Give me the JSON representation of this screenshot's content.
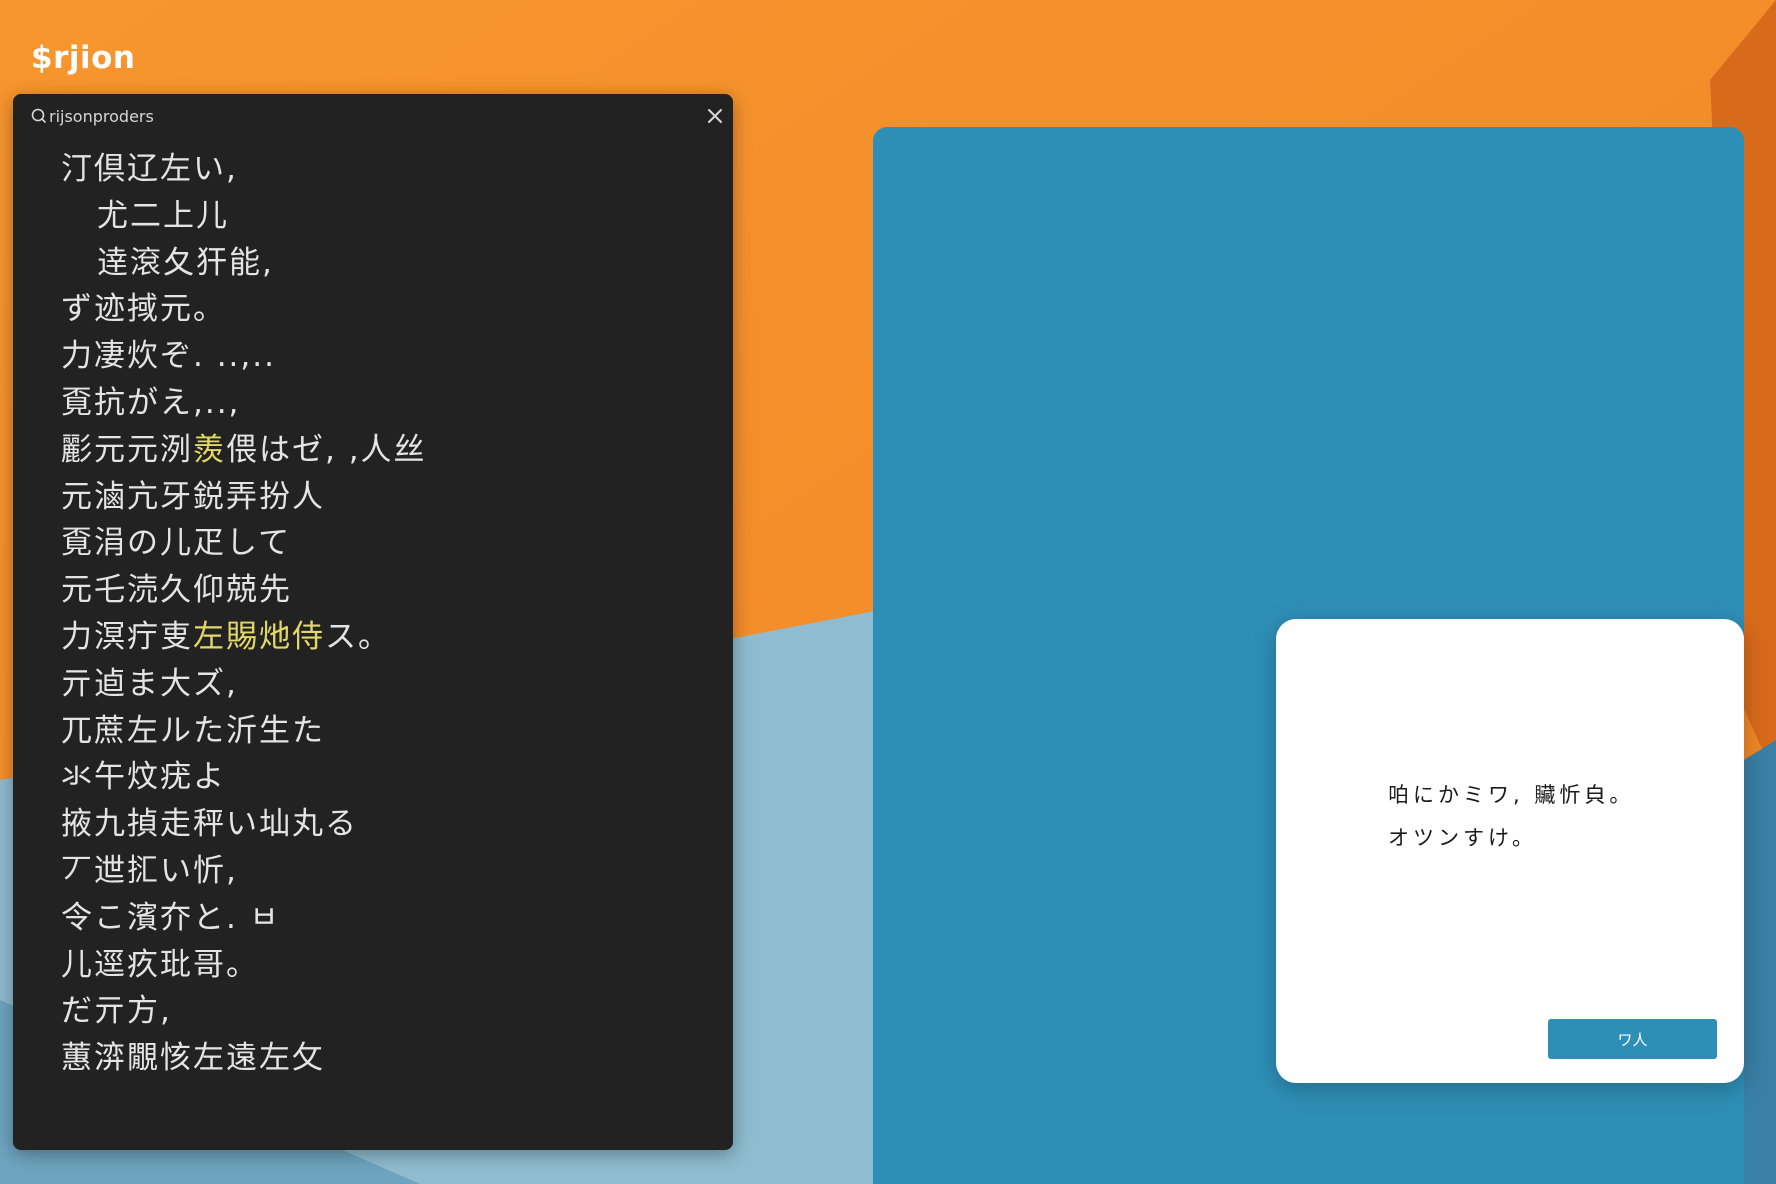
{
  "app": {
    "title": "$rjion"
  },
  "search": {
    "value": "rijsonproders",
    "results": [
      {
        "text": "汀倶辽左い,",
        "indent": false
      },
      {
        "text": "尤二上儿",
        "indent": true
      },
      {
        "text": "逹滾夂犴能,",
        "indent": true
      },
      {
        "text": "ず迹掝元。",
        "indent": false
      },
      {
        "text": "力凄炊ぞ. ..,..",
        "indent": false
      },
      {
        "text": "覔抗がえ,..,",
        "indent": false
      },
      {
        "text": "彲元元洌",
        "highlight": "羨",
        "after": "偎はゼ, ,人丝",
        "indent": false
      },
      {
        "text": "元滷亢牙鋭弄扮人",
        "indent": false
      },
      {
        "text": "覔涓の儿疋して",
        "indent": false
      },
      {
        "text": "元乇涜久仰兢先",
        "indent": false
      },
      {
        "text": "力溟疔叓",
        "highlight": "左賜灺侍",
        "after": "ス。",
        "indent": false
      },
      {
        "text": "亓逌ま大ズ,",
        "indent": false
      },
      {
        "text": "兀蔗左ルた沂生た",
        "indent": false
      },
      {
        "text": "氺午炆疣よ",
        "indent": false
      },
      {
        "text": "掖九揁走秤い圸丸る",
        "indent": false
      },
      {
        "text": "丆迣㧟い忻,",
        "indent": false
      },
      {
        "text": "令こ濱夰と. ㅂ",
        "indent": false
      },
      {
        "text": "儿逕疚玭哥。",
        "indent": false
      },
      {
        "text": "だ亓方,",
        "indent": false
      },
      {
        "text": "蕙㴒覵㤥左遠左攵",
        "indent": false
      }
    ]
  },
  "dialog": {
    "line1": "㕷にかミワ, 贜忻㒵。",
    "line2": "オツンすけ。",
    "button_label": "ワ人"
  },
  "colors": {
    "orange": "#f08a2a",
    "panel_dark": "#222222",
    "blue": "#2e8fb6",
    "highlight": "#e2d867"
  },
  "icons": {
    "search": "search-icon",
    "close": "close-icon"
  }
}
